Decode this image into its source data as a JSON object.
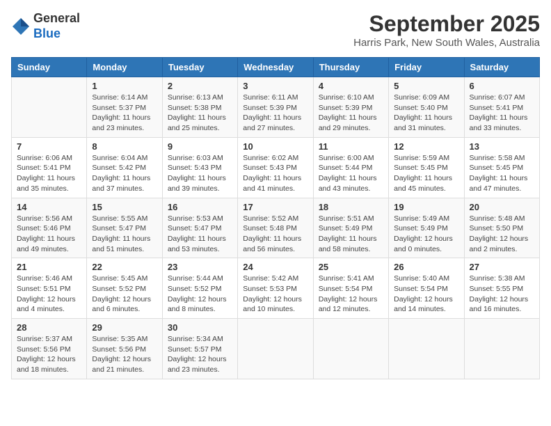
{
  "logo": {
    "general": "General",
    "blue": "Blue"
  },
  "header": {
    "month": "September 2025",
    "location": "Harris Park, New South Wales, Australia"
  },
  "weekdays": [
    "Sunday",
    "Monday",
    "Tuesday",
    "Wednesday",
    "Thursday",
    "Friday",
    "Saturday"
  ],
  "weeks": [
    [
      {
        "day": "",
        "sunrise": "",
        "sunset": "",
        "daylight": ""
      },
      {
        "day": "1",
        "sunrise": "Sunrise: 6:14 AM",
        "sunset": "Sunset: 5:37 PM",
        "daylight": "Daylight: 11 hours and 23 minutes."
      },
      {
        "day": "2",
        "sunrise": "Sunrise: 6:13 AM",
        "sunset": "Sunset: 5:38 PM",
        "daylight": "Daylight: 11 hours and 25 minutes."
      },
      {
        "day": "3",
        "sunrise": "Sunrise: 6:11 AM",
        "sunset": "Sunset: 5:39 PM",
        "daylight": "Daylight: 11 hours and 27 minutes."
      },
      {
        "day": "4",
        "sunrise": "Sunrise: 6:10 AM",
        "sunset": "Sunset: 5:39 PM",
        "daylight": "Daylight: 11 hours and 29 minutes."
      },
      {
        "day": "5",
        "sunrise": "Sunrise: 6:09 AM",
        "sunset": "Sunset: 5:40 PM",
        "daylight": "Daylight: 11 hours and 31 minutes."
      },
      {
        "day": "6",
        "sunrise": "Sunrise: 6:07 AM",
        "sunset": "Sunset: 5:41 PM",
        "daylight": "Daylight: 11 hours and 33 minutes."
      }
    ],
    [
      {
        "day": "7",
        "sunrise": "Sunrise: 6:06 AM",
        "sunset": "Sunset: 5:41 PM",
        "daylight": "Daylight: 11 hours and 35 minutes."
      },
      {
        "day": "8",
        "sunrise": "Sunrise: 6:04 AM",
        "sunset": "Sunset: 5:42 PM",
        "daylight": "Daylight: 11 hours and 37 minutes."
      },
      {
        "day": "9",
        "sunrise": "Sunrise: 6:03 AM",
        "sunset": "Sunset: 5:43 PM",
        "daylight": "Daylight: 11 hours and 39 minutes."
      },
      {
        "day": "10",
        "sunrise": "Sunrise: 6:02 AM",
        "sunset": "Sunset: 5:43 PM",
        "daylight": "Daylight: 11 hours and 41 minutes."
      },
      {
        "day": "11",
        "sunrise": "Sunrise: 6:00 AM",
        "sunset": "Sunset: 5:44 PM",
        "daylight": "Daylight: 11 hours and 43 minutes."
      },
      {
        "day": "12",
        "sunrise": "Sunrise: 5:59 AM",
        "sunset": "Sunset: 5:45 PM",
        "daylight": "Daylight: 11 hours and 45 minutes."
      },
      {
        "day": "13",
        "sunrise": "Sunrise: 5:58 AM",
        "sunset": "Sunset: 5:45 PM",
        "daylight": "Daylight: 11 hours and 47 minutes."
      }
    ],
    [
      {
        "day": "14",
        "sunrise": "Sunrise: 5:56 AM",
        "sunset": "Sunset: 5:46 PM",
        "daylight": "Daylight: 11 hours and 49 minutes."
      },
      {
        "day": "15",
        "sunrise": "Sunrise: 5:55 AM",
        "sunset": "Sunset: 5:47 PM",
        "daylight": "Daylight: 11 hours and 51 minutes."
      },
      {
        "day": "16",
        "sunrise": "Sunrise: 5:53 AM",
        "sunset": "Sunset: 5:47 PM",
        "daylight": "Daylight: 11 hours and 53 minutes."
      },
      {
        "day": "17",
        "sunrise": "Sunrise: 5:52 AM",
        "sunset": "Sunset: 5:48 PM",
        "daylight": "Daylight: 11 hours and 56 minutes."
      },
      {
        "day": "18",
        "sunrise": "Sunrise: 5:51 AM",
        "sunset": "Sunset: 5:49 PM",
        "daylight": "Daylight: 11 hours and 58 minutes."
      },
      {
        "day": "19",
        "sunrise": "Sunrise: 5:49 AM",
        "sunset": "Sunset: 5:49 PM",
        "daylight": "Daylight: 12 hours and 0 minutes."
      },
      {
        "day": "20",
        "sunrise": "Sunrise: 5:48 AM",
        "sunset": "Sunset: 5:50 PM",
        "daylight": "Daylight: 12 hours and 2 minutes."
      }
    ],
    [
      {
        "day": "21",
        "sunrise": "Sunrise: 5:46 AM",
        "sunset": "Sunset: 5:51 PM",
        "daylight": "Daylight: 12 hours and 4 minutes."
      },
      {
        "day": "22",
        "sunrise": "Sunrise: 5:45 AM",
        "sunset": "Sunset: 5:52 PM",
        "daylight": "Daylight: 12 hours and 6 minutes."
      },
      {
        "day": "23",
        "sunrise": "Sunrise: 5:44 AM",
        "sunset": "Sunset: 5:52 PM",
        "daylight": "Daylight: 12 hours and 8 minutes."
      },
      {
        "day": "24",
        "sunrise": "Sunrise: 5:42 AM",
        "sunset": "Sunset: 5:53 PM",
        "daylight": "Daylight: 12 hours and 10 minutes."
      },
      {
        "day": "25",
        "sunrise": "Sunrise: 5:41 AM",
        "sunset": "Sunset: 5:54 PM",
        "daylight": "Daylight: 12 hours and 12 minutes."
      },
      {
        "day": "26",
        "sunrise": "Sunrise: 5:40 AM",
        "sunset": "Sunset: 5:54 PM",
        "daylight": "Daylight: 12 hours and 14 minutes."
      },
      {
        "day": "27",
        "sunrise": "Sunrise: 5:38 AM",
        "sunset": "Sunset: 5:55 PM",
        "daylight": "Daylight: 12 hours and 16 minutes."
      }
    ],
    [
      {
        "day": "28",
        "sunrise": "Sunrise: 5:37 AM",
        "sunset": "Sunset: 5:56 PM",
        "daylight": "Daylight: 12 hours and 18 minutes."
      },
      {
        "day": "29",
        "sunrise": "Sunrise: 5:35 AM",
        "sunset": "Sunset: 5:56 PM",
        "daylight": "Daylight: 12 hours and 21 minutes."
      },
      {
        "day": "30",
        "sunrise": "Sunrise: 5:34 AM",
        "sunset": "Sunset: 5:57 PM",
        "daylight": "Daylight: 12 hours and 23 minutes."
      },
      {
        "day": "",
        "sunrise": "",
        "sunset": "",
        "daylight": ""
      },
      {
        "day": "",
        "sunrise": "",
        "sunset": "",
        "daylight": ""
      },
      {
        "day": "",
        "sunrise": "",
        "sunset": "",
        "daylight": ""
      },
      {
        "day": "",
        "sunrise": "",
        "sunset": "",
        "daylight": ""
      }
    ]
  ]
}
